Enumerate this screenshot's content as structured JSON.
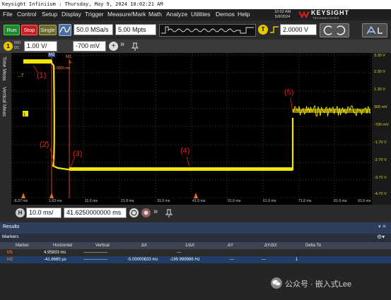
{
  "title_bar": "Keysight Infiniium : Thursday, May 9, 2024 10:02:21 AM",
  "menu": [
    "File",
    "Control",
    "Setup",
    "Display",
    "Trigger",
    "Measure/Mark",
    "Math",
    "Analyze",
    "Utilities",
    "Demos",
    "Help"
  ],
  "datetime": {
    "time": "10:02 AM",
    "date": "5/9/2024"
  },
  "brand": {
    "name": "KEYSIGHT",
    "sub": "TECHNOLOGIES"
  },
  "toolbar": {
    "run": "Run",
    "stop": "Stop",
    "single": "Single",
    "sample_rate": "50.0 MSa/s",
    "memory": "5.00 Mpts",
    "trigger_level": "2.0000 V"
  },
  "channel": {
    "number": "1",
    "coupling": "50Ω DC",
    "scale": "1.00 V/",
    "offset": "-700 mV"
  },
  "side_tabs": [
    "Time Meas",
    "Vertical Meas"
  ],
  "volt_labels": [
    "3.30 V",
    "2.30 V",
    "1.30 V",
    "300 mV",
    "-700 mV",
    "-1.70 V",
    "-2.70 V",
    "-3.70 V",
    "-4.70 V"
  ],
  "time_labels": [
    "-8.37 ms",
    "1.63 ms",
    "11.6 ms",
    "21.6 ms",
    "31.6 ms",
    "41.6 ms",
    "51.6 ms",
    "61.6 ms",
    "71.6 ms",
    "81.6 ms",
    "91.6 ms"
  ],
  "markers_on_plot": {
    "m1": "M1",
    "m2": "M2",
    "k": "K-",
    "delta": "-5.0000 ms"
  },
  "horizontal": {
    "scale": "10.0 ms/",
    "position": "41.6250000000 ms"
  },
  "results": {
    "title": "Results",
    "section": "Markers",
    "columns": [
      "Marker",
      "Horizontal",
      "Vertical",
      "ΔX",
      "1/ΔX",
      "ΔY",
      "ΔY/ΔX",
      "Delta To"
    ],
    "rows": [
      {
        "marker": "M1",
        "horizontal": "4.95833 ms",
        "vertical": "-----------------",
        "dx": "",
        "inv_dx": "---",
        "dy": "",
        "dydx": "",
        "delta_to": ""
      },
      {
        "marker": "M2",
        "horizontal": "-41.6660 µs",
        "vertical": "-----------------",
        "dx": "-5.00000833 ms",
        "inv_dx": "-199.999986 Hz",
        "dy": "---",
        "dydx": "---",
        "delta_to": "1"
      }
    ]
  },
  "annotations": [
    "(1)",
    "(2)",
    "(3)",
    "(4)",
    "(5)"
  ],
  "watermark": "公众号 · 嵌入式Lee",
  "colors": {
    "trace": "#f2e600",
    "annotation": "#e82020",
    "background": "#000000"
  }
}
